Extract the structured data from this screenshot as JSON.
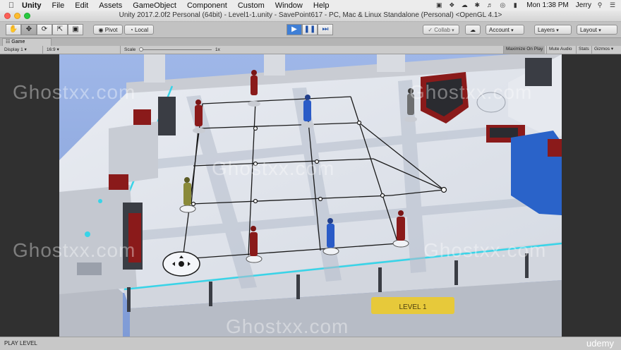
{
  "menubar": {
    "items": [
      "Unity",
      "File",
      "Edit",
      "Assets",
      "GameObject",
      "Component",
      "Custom",
      "Window",
      "Help"
    ],
    "status": {
      "time": "Mon 1:38 PM",
      "user": "Jerry",
      "icons": [
        "dropbox-icon",
        "cloud-icon",
        "bluetooth-icon",
        "volume-icon",
        "wifi-icon",
        "battery-icon",
        "search-icon",
        "list-icon"
      ]
    }
  },
  "window": {
    "title": "Unity 2017.2.0f2 Personal (64bit) - Level1-1.unity - SavePoint617 - PC, Mac & Linux Standalone (Personal) <OpenGL 4.1>"
  },
  "toolbar": {
    "pivot": "Pivot",
    "local": "Local",
    "collab": "Collab",
    "account": "Account",
    "layers": "Layers",
    "layout": "Layout"
  },
  "game_view": {
    "tab": "Game",
    "display": "Display 1",
    "aspect": "16:9",
    "scale_label": "Scale",
    "scale_value": "1x",
    "maximize": "Maximize On Play",
    "mute": "Mute Audio",
    "stats": "Stats",
    "gizmos": "Gizmos"
  },
  "scene": {
    "level_sign": "LEVEL 1",
    "watermarks": [
      "Ghostxx.com",
      "Ghostxx.com",
      "Ghostxx.com",
      "Ghostxx.com",
      "Ghostxx.com",
      "Ghostxx.com",
      "Ghostxx.com"
    ]
  },
  "statusbar": {
    "message": "PLAY LEVEL",
    "brand": "udemy"
  },
  "colors": {
    "play_active": "#3f7fd6",
    "grid_line": "#1a1a1a",
    "accent_cyan": "#38d4e8",
    "enemy_red": "#8a1a1a",
    "friendly_blue": "#2a5bc7"
  }
}
